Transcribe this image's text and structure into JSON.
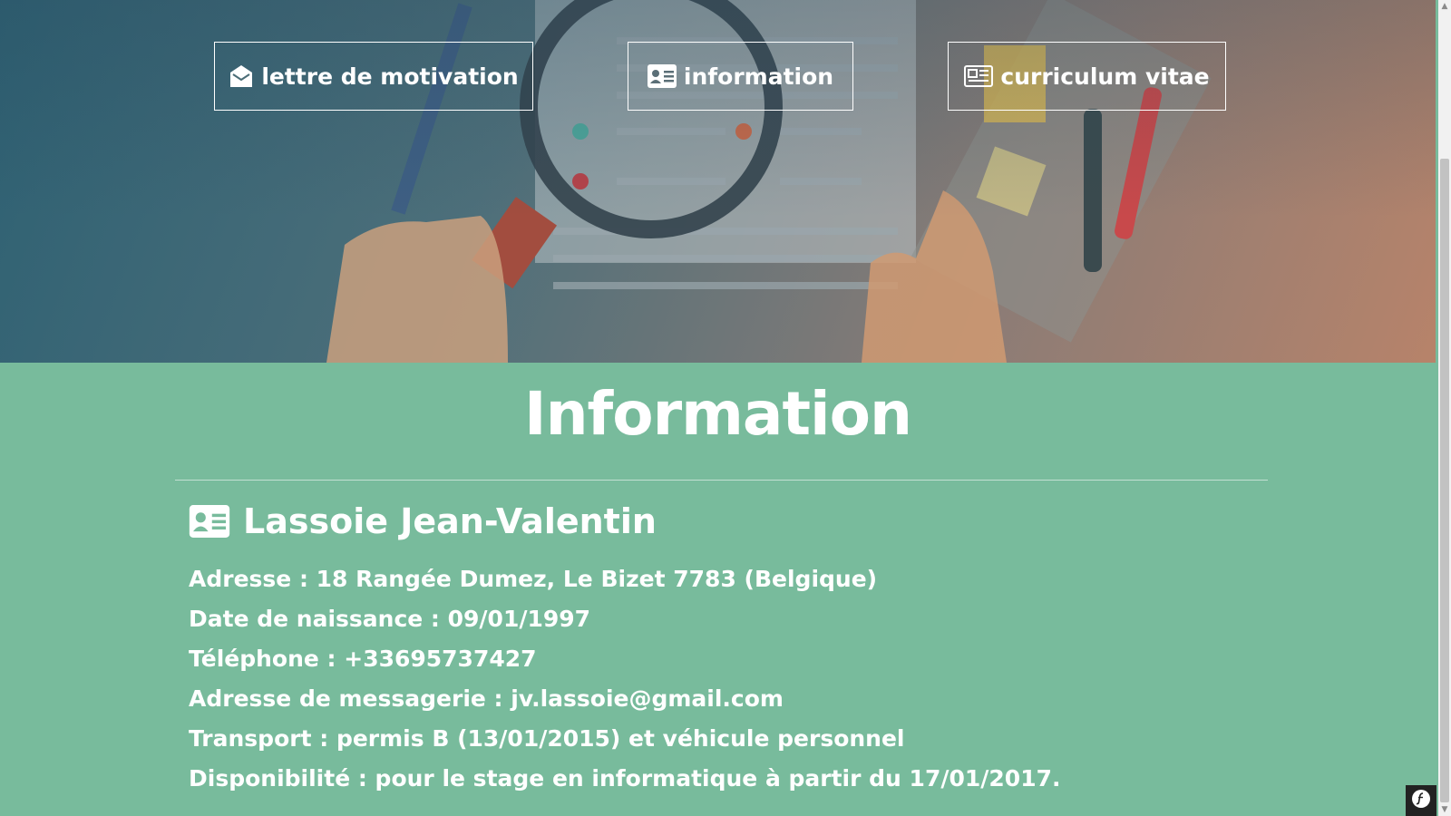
{
  "nav": {
    "lettre_label": "lettre de motivation",
    "info_label": "information",
    "cv_label": "curriculum vitae"
  },
  "section": {
    "title": "Information"
  },
  "person": {
    "name": "Lassoie Jean-Valentin"
  },
  "details": [
    "Adresse : 18 Rangée Dumez, Le Bizet 7783 (Belgique)",
    "Date de naissance : 09/01/1997",
    "Téléphone : +33695737427",
    "Adresse de messagerie : jv.lassoie@gmail.com",
    "Transport : permis B (13/01/2015) et véhicule personnel",
    "Disponibilité : pour le stage en informatique à partir du 17/01/2017."
  ],
  "colors": {
    "section_bg": "#78bb9c",
    "text": "#ffffff"
  },
  "icons": {
    "lettre": "envelope-open-icon",
    "info": "id-card-icon",
    "cv": "newspaper-icon",
    "person": "id-card-icon",
    "badge": "symfony-icon"
  }
}
